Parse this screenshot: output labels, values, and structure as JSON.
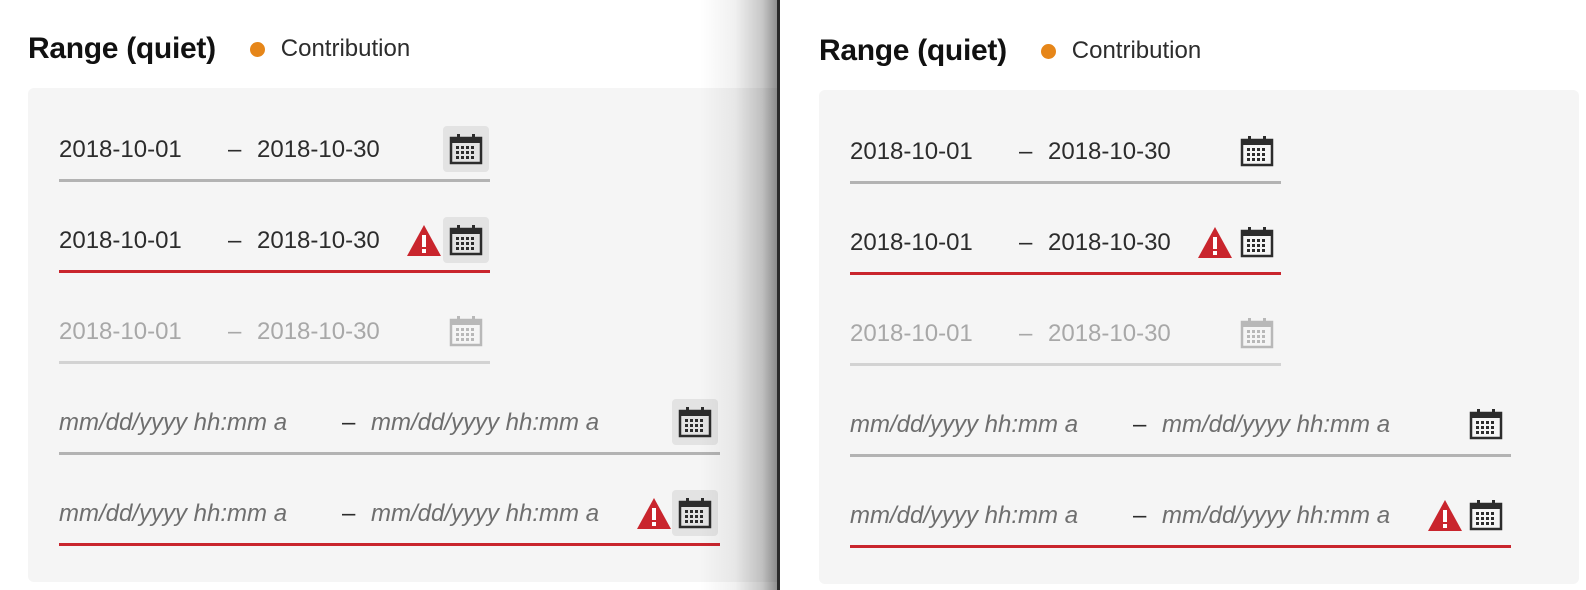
{
  "panels": [
    {
      "title": "Range (quiet)",
      "status_label": "Contribution",
      "fields": [
        {
          "start": "2018-10-01",
          "separator": "–",
          "end": "2018-10-30"
        },
        {
          "start": "2018-10-01",
          "separator": "–",
          "end": "2018-10-30"
        },
        {
          "start": "2018-10-01",
          "separator": "–",
          "end": "2018-10-30"
        },
        {
          "start_placeholder": "mm/dd/yyyy hh:mm a",
          "separator": "–",
          "end_placeholder": "mm/dd/yyyy hh:mm a"
        },
        {
          "start_placeholder": "mm/dd/yyyy hh:mm a",
          "separator": "–",
          "end_placeholder": "mm/dd/yyyy hh:mm a"
        }
      ]
    },
    {
      "title": "Range (quiet)",
      "status_label": "Contribution",
      "fields": [
        {
          "start": "2018-10-01",
          "separator": "–",
          "end": "2018-10-30"
        },
        {
          "start": "2018-10-01",
          "separator": "–",
          "end": "2018-10-30"
        },
        {
          "start": "2018-10-01",
          "separator": "–",
          "end": "2018-10-30"
        },
        {
          "start_placeholder": "mm/dd/yyyy hh:mm a",
          "separator": "–",
          "end_placeholder": "mm/dd/yyyy hh:mm a"
        },
        {
          "start_placeholder": "mm/dd/yyyy hh:mm a",
          "separator": "–",
          "end_placeholder": "mm/dd/yyyy hh:mm a"
        }
      ]
    }
  ],
  "icons": {
    "calendar": "calendar-icon",
    "alert": "alert-icon"
  },
  "colors": {
    "status_dot": "#e68619",
    "invalid": "#c9252d",
    "underline": "#b3b3b3",
    "disabled_text": "#a8a8a8"
  }
}
